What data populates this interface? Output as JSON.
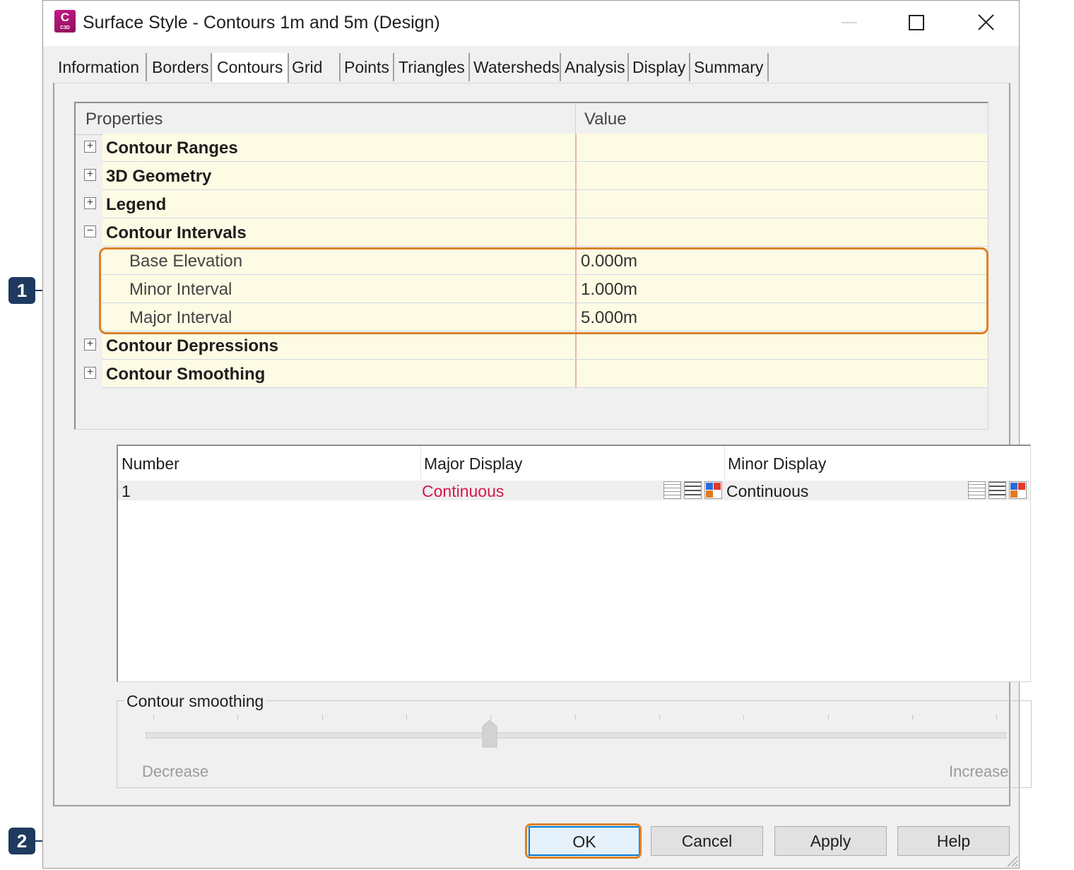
{
  "window": {
    "title": "Surface Style - Contours 1m and 5m (Design)",
    "icon": {
      "name": "civil3d-app-icon",
      "letter": "C",
      "sub": "C3D",
      "color": "#b0167a"
    }
  },
  "tabs": [
    "Information",
    "Borders",
    "Contours",
    "Grid",
    "Points",
    "Triangles",
    "Watersheds",
    "Analysis",
    "Display",
    "Summary"
  ],
  "active_tab": "Contours",
  "property_grid": {
    "headers": {
      "properties": "Properties",
      "value": "Value"
    },
    "rows": [
      {
        "label": "Contour Ranges",
        "type": "category",
        "expanded": false,
        "expander": "+"
      },
      {
        "label": "3D Geometry",
        "type": "category",
        "expanded": false,
        "expander": "+"
      },
      {
        "label": "Legend",
        "type": "category",
        "expanded": false,
        "expander": "+"
      },
      {
        "label": "Contour Intervals",
        "type": "category",
        "expanded": true,
        "expander": "−"
      },
      {
        "label": "Base Elevation",
        "type": "property",
        "value": "0.000m"
      },
      {
        "label": "Minor Interval",
        "type": "property",
        "value": "1.000m"
      },
      {
        "label": "Major Interval",
        "type": "property",
        "value": "5.000m"
      },
      {
        "label": "Contour Depressions",
        "type": "category",
        "expanded": false,
        "expander": "+"
      },
      {
        "label": "Contour Smoothing",
        "type": "category",
        "expanded": false,
        "expander": "+"
      }
    ]
  },
  "display_grid": {
    "headers": {
      "number": "Number",
      "major": "Major Display",
      "minor": "Minor Display"
    },
    "row": {
      "number": "1",
      "major": "Continuous",
      "minor": "Continuous",
      "major_color": "#d6184b"
    }
  },
  "smoothing": {
    "label": "Contour smoothing",
    "min_label": "Decrease",
    "max_label": "Increase",
    "level_fraction": 0.4
  },
  "buttons": {
    "ok": "OK",
    "cancel": "Cancel",
    "apply": "Apply",
    "help": "Help"
  },
  "callouts": [
    "1",
    "2"
  ],
  "colors": {
    "highlight": "#d9822b",
    "callout": "#1f3a5f",
    "grid_bg": "#fdfbe3"
  }
}
